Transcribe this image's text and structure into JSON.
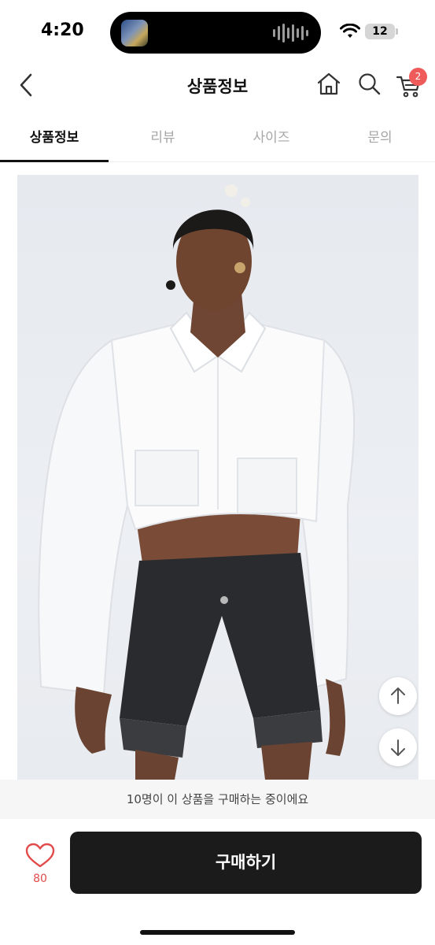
{
  "status_bar": {
    "time": "4:20",
    "battery": "12"
  },
  "header": {
    "title": "상품정보",
    "cart_count": "2"
  },
  "tabs": [
    {
      "label": "상품정보",
      "active": true
    },
    {
      "label": "리뷰",
      "active": false
    },
    {
      "label": "사이즈",
      "active": false
    },
    {
      "label": "문의",
      "active": false
    }
  ],
  "product_image": {
    "description_icon": "product-photo"
  },
  "notice": {
    "text": "10명이 이 상품을 구매하는 중이에요"
  },
  "bottom_bar": {
    "like_count": "80",
    "buy_label": "구매하기"
  },
  "colors": {
    "accent_red": "#ef5a5a",
    "buy_button": "#1b1b1b"
  }
}
